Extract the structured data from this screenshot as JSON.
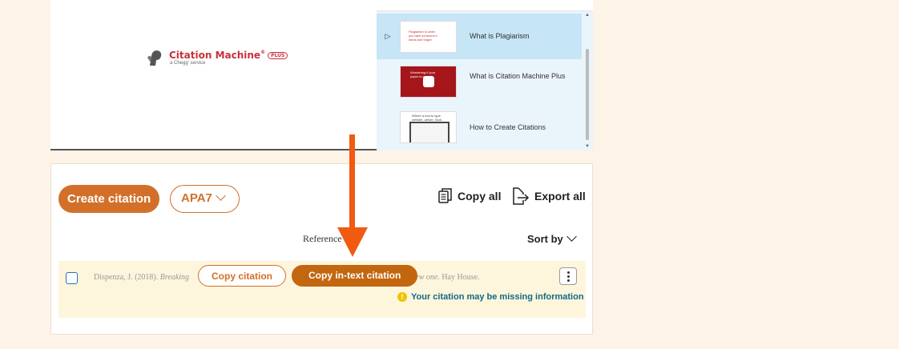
{
  "video": {
    "logo": {
      "title": "Citation Machine",
      "reg": "®",
      "badge": "PLUS",
      "subtitle": "a Chegg' service"
    },
    "playlist": [
      {
        "title": "What is Plagiarism",
        "thumb_text": "Plagiarism is when you take someone's ideas and forget",
        "active": true
      },
      {
        "title": "What is Citation Machine Plus",
        "thumb_text": "Wondering if your paper is ready?",
        "active": false
      },
      {
        "title": "How to Create Citations",
        "thumb_text": "Where a tool to type website, article, book, etc.",
        "active": false
      }
    ]
  },
  "toolbar": {
    "create_label": "Create citation",
    "style_label": "APA7",
    "copy_all_label": "Copy all",
    "export_all_label": "Export all"
  },
  "list": {
    "header_label": "Reference",
    "sort_label": "Sort by"
  },
  "citation": {
    "author_year": "Dispenza, J. (2018).",
    "title_start": "Breaking",
    "title_end": "te a new one.",
    "publisher": "Hay House.",
    "copy_label": "Copy citation",
    "copy_intext_label": "Copy in-text citation",
    "warning": "Your citation may be missing information"
  },
  "colors": {
    "brand": "#d2702a",
    "arrow": "#f15a11",
    "background": "#fdf3e6"
  }
}
